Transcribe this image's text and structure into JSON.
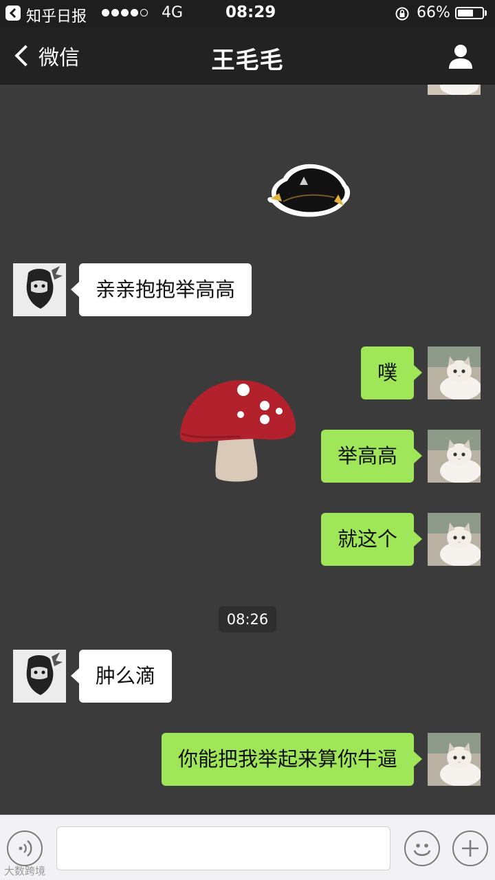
{
  "status_bar": {
    "app_name": "知乎日报",
    "network": "4G",
    "time": "08:29",
    "battery_percent": "66%",
    "battery_level": 0.66,
    "signal_dots": [
      true,
      true,
      true,
      true,
      false
    ]
  },
  "nav": {
    "back_label": "微信",
    "title": "王毛毛",
    "profile_icon": "person-icon"
  },
  "messages": [
    {
      "sender": "friend",
      "text": "亲亲抱抱举高高"
    },
    {
      "sender": "me",
      "text": "噗"
    },
    {
      "sender": "me",
      "text": "举高高"
    },
    {
      "sender": "me",
      "text": "就这个"
    },
    {
      "sender": "friend",
      "text": "肿么滴"
    },
    {
      "sender": "me",
      "text": "你能把我举起来算你牛逼"
    }
  ],
  "timestamp": "08:26",
  "input_bar": {
    "voice_icon": "voice-icon",
    "emoji_icon": "emoji-icon",
    "plus_icon": "plus-icon"
  },
  "watermark": "大数跨境",
  "colors": {
    "chat_bg": "#3b3b3b",
    "bubble_me": "#9fe658",
    "bubble_friend": "#ffffff",
    "nav_bg": "#222222"
  }
}
